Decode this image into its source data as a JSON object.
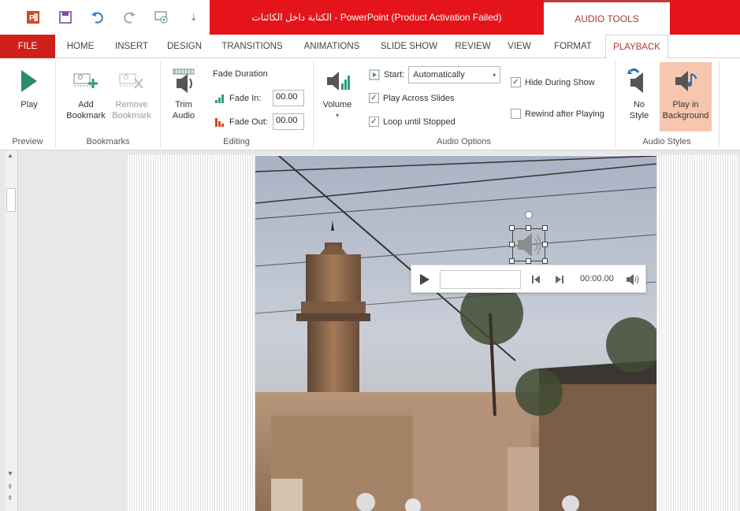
{
  "title_bar": {
    "title": "الكتابة داخل الكائنات  - PowerPoint (Product Activation Failed)",
    "tools_tab": "AUDIO TOOLS"
  },
  "quick_access": {
    "icons": [
      "powerpoint-logo-icon",
      "save-icon",
      "undo-icon",
      "redo-icon",
      "start-from-beginning-icon",
      "customize-qat-icon"
    ],
    "customize_glyph": "⇣"
  },
  "tabs": [
    "FILE",
    "HOME",
    "INSERT",
    "DESIGN",
    "TRANSITIONS",
    "ANIMATIONS",
    "SLIDE SHOW",
    "REVIEW",
    "VIEW",
    "FORMAT",
    "PLAYBACK"
  ],
  "active_tab": "PLAYBACK",
  "ribbon": {
    "preview": {
      "play_label": "Play",
      "group_label": "Preview"
    },
    "bookmarks": {
      "add_line1": "Add",
      "add_line2": "Bookmark",
      "remove_line1": "Remove",
      "remove_line2": "Bookmark",
      "group_label": "Bookmarks"
    },
    "editing": {
      "trim_line1": "Trim",
      "trim_line2": "Audio",
      "fade_duration_label": "Fade Duration",
      "fade_in_label": "Fade In:",
      "fade_in_value": "00.00",
      "fade_out_label": "Fade Out:",
      "fade_out_value": "00.00",
      "group_label": "Editing"
    },
    "audio_options": {
      "volume_label": "Volume",
      "start_label": "Start:",
      "start_value": "Automatically",
      "play_across_slides": "Play Across Slides",
      "play_across_checked": true,
      "loop_until_stopped": "Loop until Stopped",
      "loop_checked": true,
      "hide_during_show": "Hide During Show",
      "hide_checked": true,
      "rewind_after_playing": "Rewind after Playing",
      "rewind_checked": false,
      "group_label": "Audio Options"
    },
    "audio_styles": {
      "no_style_line1": "No",
      "no_style_line2": "Style",
      "play_bg_line1": "Play in",
      "play_bg_line2": "Background",
      "group_label": "Audio Styles"
    }
  },
  "player": {
    "time": "00:00.00"
  },
  "colors": {
    "title_red": "#e5141b",
    "accent": "#a8383a",
    "selected_style": "#f6c6ae",
    "play_green": "#2e8b6e"
  }
}
